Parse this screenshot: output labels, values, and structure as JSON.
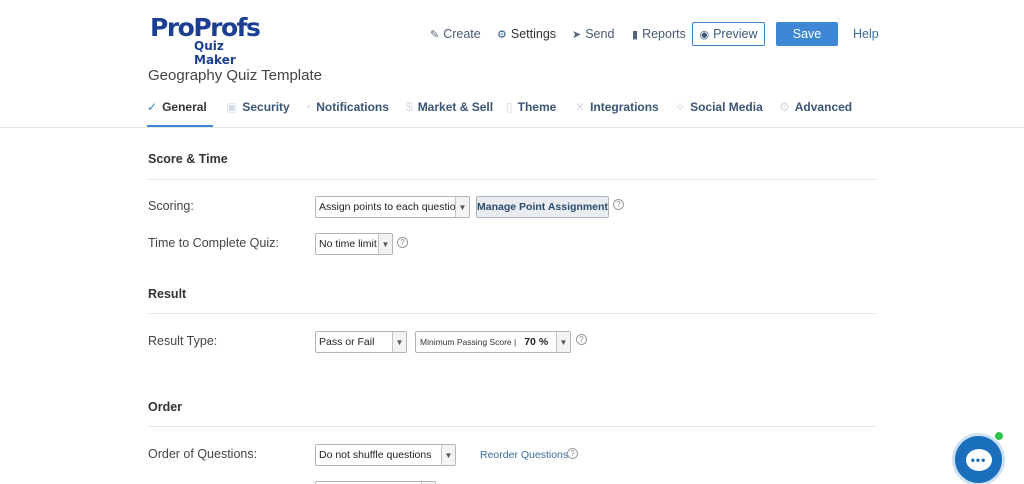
{
  "logo": {
    "brand_part1": "Pro",
    "brand_part2": "Profs",
    "subtitle": "Quiz Maker"
  },
  "topnav": {
    "create": "Create",
    "settings": "Settings",
    "send": "Send",
    "reports": "Reports",
    "preview": "Preview",
    "save": "Save",
    "help": "Help"
  },
  "quiz_title": "Geography Quiz Template",
  "tabs": [
    {
      "label": "General",
      "icon": "check-circle-icon",
      "active": true
    },
    {
      "label": "Security",
      "icon": "lock-icon"
    },
    {
      "label": "Notifications",
      "icon": "bell-icon"
    },
    {
      "label": "Market & Sell",
      "icon": "dollar-icon"
    },
    {
      "label": "Theme",
      "icon": "paint-bucket-icon"
    },
    {
      "label": "Integrations",
      "icon": "tools-icon"
    },
    {
      "label": "Social Media",
      "icon": "share-icon"
    },
    {
      "label": "Advanced",
      "icon": "gears-icon"
    }
  ],
  "score_time": {
    "title": "Score & Time",
    "scoring_label": "Scoring:",
    "scoring_value": "Assign points to each question",
    "manage_button": "Manage Point Assignment",
    "time_label": "Time to Complete Quiz:",
    "time_value": "No time limit"
  },
  "result": {
    "title": "Result",
    "type_label": "Result Type:",
    "type_value": "Pass or Fail",
    "min_passing_label": "Minimum Passing Score |",
    "min_passing_value": "70 %"
  },
  "order": {
    "title": "Order",
    "questions_label": "Order of Questions:",
    "questions_value": "Do not shuffle questions",
    "reorder_link": "Reorder Questions"
  },
  "colors": {
    "accent": "#3d87d4",
    "brand": "#1c3f94",
    "chat": "#1a6fbd",
    "online": "#2ec24a"
  }
}
